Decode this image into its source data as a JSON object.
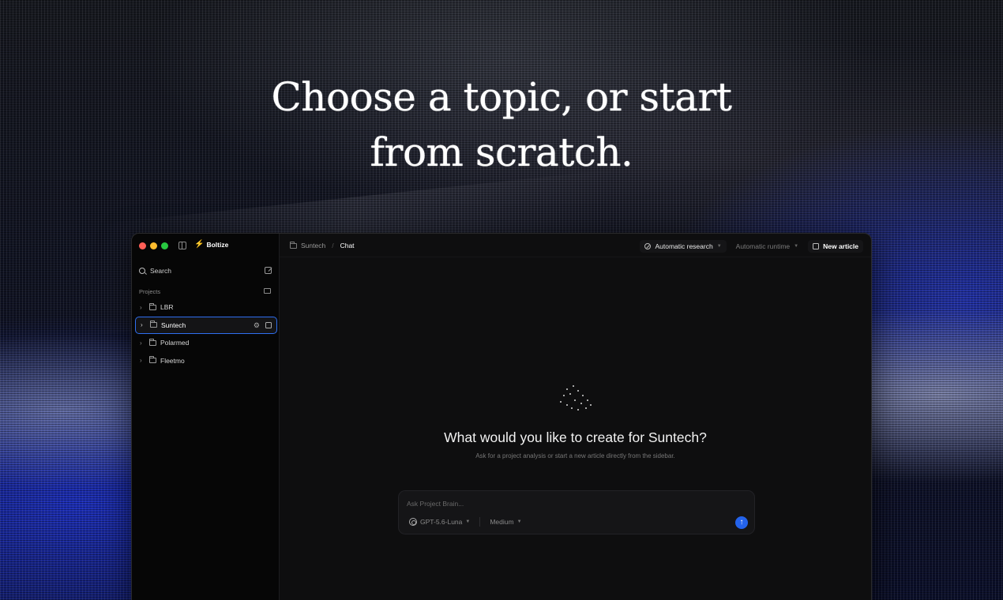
{
  "headline": {
    "line1": "Choose a topic, or start",
    "line2": "from scratch."
  },
  "app": {
    "brand": "Boltize",
    "accent_color": "#2463eb",
    "sidebar": {
      "search_label": "Search",
      "projects_label": "Projects",
      "projects": [
        {
          "name": "LBR",
          "active": false
        },
        {
          "name": "Suntech",
          "active": true
        },
        {
          "name": "Polarmed",
          "active": false
        },
        {
          "name": "Fleetmo",
          "active": false
        }
      ]
    },
    "topbar": {
      "breadcrumb_project": "Suntech",
      "breadcrumb_current": "Chat",
      "research_label": "Automatic research",
      "runtime_label": "Automatic runtime",
      "new_article_label": "New article"
    },
    "main": {
      "title": "What would you like to create for Suntech?",
      "subtitle": "Ask for a project analysis or start a new article directly from the sidebar.",
      "composer_placeholder": "Ask Project Brain...",
      "model": "GPT-5.6-Luna",
      "effort": "Medium"
    }
  }
}
